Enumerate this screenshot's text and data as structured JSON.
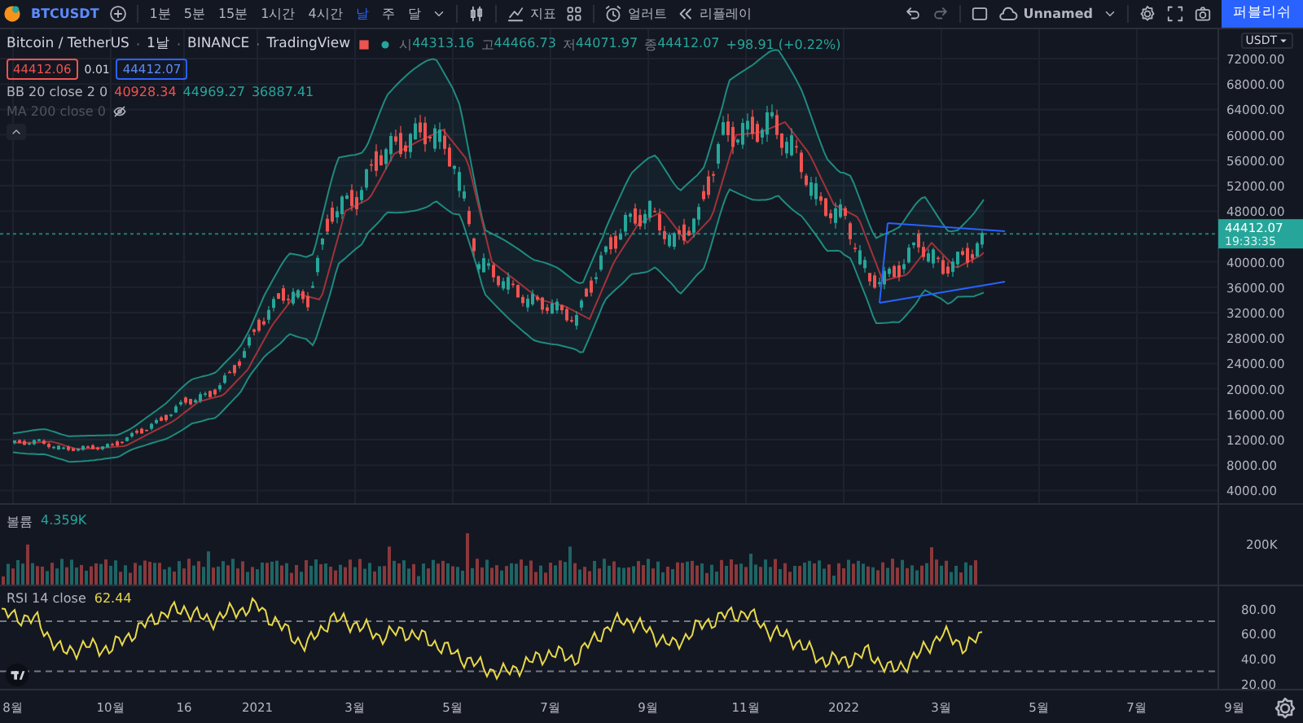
{
  "toolbar": {
    "symbol": "BTCUSDT",
    "intervals": [
      {
        "label": "1분",
        "selected": false
      },
      {
        "label": "5분",
        "selected": false
      },
      {
        "label": "15분",
        "selected": false
      },
      {
        "label": "1시간",
        "selected": false
      },
      {
        "label": "4시간",
        "selected": false
      },
      {
        "label": "날",
        "selected": true
      },
      {
        "label": "주",
        "selected": false
      },
      {
        "label": "달",
        "selected": false
      }
    ],
    "indicators_label": "지표",
    "alerts_label": "얼러트",
    "replay_label": "리플레이",
    "layout_name": "Unnamed",
    "publish_button": "퍼블리쉬"
  },
  "legend": {
    "title_parts": [
      "Bitcoin / TetherUS",
      "1날",
      "BINANCE",
      "TradingView"
    ],
    "separator": "·",
    "ohlc": [
      {
        "label": "시",
        "value": "44313.16"
      },
      {
        "label": "고",
        "value": "44466.73"
      },
      {
        "label": "저",
        "value": "44071.97"
      },
      {
        "label": "종",
        "value": "44412.07"
      }
    ],
    "change": "+98.91 (+0.22%)",
    "sell_price": "44412.06",
    "spread": "0.01",
    "buy_price": "44412.07",
    "indicators": [
      {
        "name": "BB 20 close 2 0",
        "hidden": false,
        "values": [
          {
            "text": "40928.34",
            "color": "#ef5350"
          },
          {
            "text": "44969.27",
            "color": "#26a69a"
          },
          {
            "text": "36887.41",
            "color": "#26a69a"
          }
        ]
      },
      {
        "name": "MA 200 close 0",
        "hidden": true
      }
    ]
  },
  "price_pane": {
    "currency": "USDT",
    "last_price": "44412.07",
    "countdown": "19:33:35",
    "axis_labels": [
      "72000.00",
      "68000.00",
      "64000.00",
      "60000.00",
      "56000.00",
      "52000.00",
      "48000.00",
      "40000.00",
      "36000.00",
      "32000.00",
      "28000.00",
      "24000.00",
      "20000.00",
      "16000.00",
      "12000.00",
      "8000.00",
      "4000.00"
    ]
  },
  "volume_pane": {
    "label": "볼륨",
    "value": "4.359K",
    "axis_label": "200K"
  },
  "rsi_pane": {
    "label": "RSI 14 close",
    "value": "62.44",
    "axis_labels": [
      "80.00",
      "60.00",
      "40.00",
      "20.00"
    ]
  },
  "time_axis": {
    "labels": [
      "8월",
      "10월",
      "16",
      "2021",
      "3월",
      "5월",
      "7월",
      "9월",
      "11월",
      "2022",
      "3월",
      "5월",
      "7월",
      "9월"
    ]
  }
}
